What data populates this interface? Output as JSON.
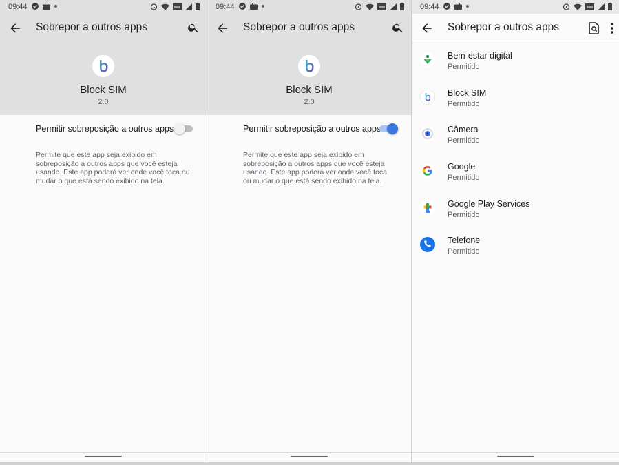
{
  "status_bar": {
    "time": "09:44"
  },
  "panel1": {
    "title": "Sobrepor a outros apps",
    "app_name": "Block SIM",
    "app_version": "2.0",
    "permission_label": "Permitir sobreposição a outros apps",
    "toggle_state": "off",
    "description": "Permite que este app seja exibido em sobreposição a outros apps que você esteja usando. Este app poderá ver onde você toca ou mudar o que está sendo exibido na tela."
  },
  "panel2": {
    "title": "Sobrepor a outros apps",
    "app_name": "Block SIM",
    "app_version": "2.0",
    "permission_label": "Permitir sobreposição a outros apps",
    "toggle_state": "on",
    "description": "Permite que este app seja exibido em sobreposição a outros apps que você esteja usando. Este app poderá ver onde você toca ou mudar o que está sendo exibido na tela."
  },
  "panel3": {
    "title": "Sobrepor a outros apps",
    "apps": [
      {
        "name": "Bem-estar digital",
        "status": "Permitido",
        "icon": "digital-wellbeing-icon"
      },
      {
        "name": "Block SIM",
        "status": "Permitido",
        "icon": "block-sim-icon"
      },
      {
        "name": "Câmera",
        "status": "Permitido",
        "icon": "camera-icon"
      },
      {
        "name": "Google",
        "status": "Permitido",
        "icon": "google-icon"
      },
      {
        "name": "Google Play Services",
        "status": "Permitido",
        "icon": "google-play-services-icon"
      },
      {
        "name": "Telefone",
        "status": "Permitido",
        "icon": "phone-icon"
      }
    ]
  },
  "colors": {
    "header_bg": "#e0e0e0",
    "page_bg": "#fafafa",
    "toggle_on": "#3a78e0",
    "toggle_off": "#bdbdbd"
  }
}
